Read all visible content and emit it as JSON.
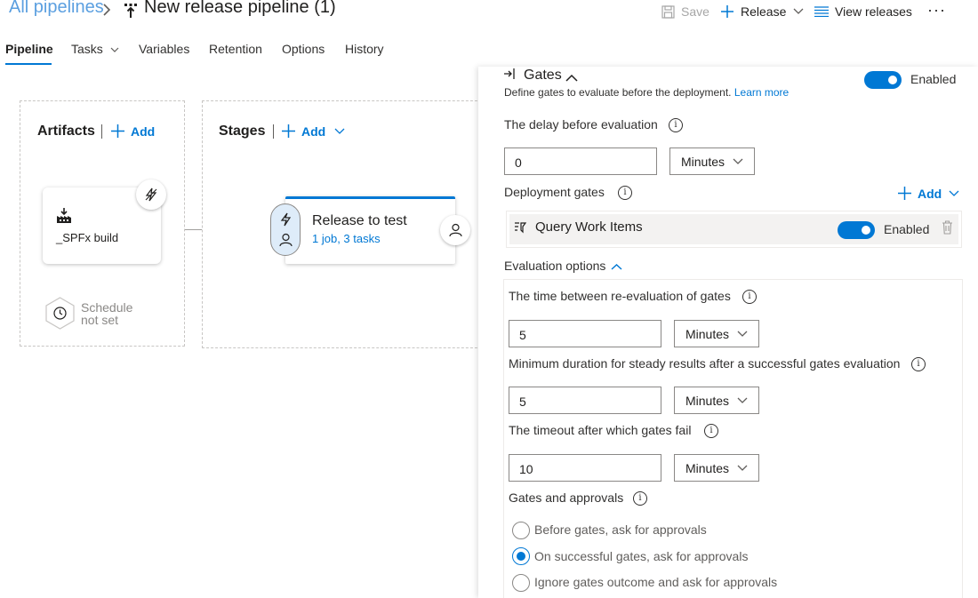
{
  "header": {
    "breadcrumb_root": "All pipelines",
    "title": "New release pipeline (1)",
    "save_label": "Save",
    "release_label": "Release",
    "view_releases_label": "View releases",
    "more_label": "···"
  },
  "tabs": [
    {
      "label": "Pipeline"
    },
    {
      "label": "Tasks"
    },
    {
      "label": "Variables"
    },
    {
      "label": "Retention"
    },
    {
      "label": "Options"
    },
    {
      "label": "History"
    }
  ],
  "artifacts": {
    "title": "Artifacts",
    "add_label": "Add",
    "card_label": "_SPFx build",
    "schedule_line1": "Schedule",
    "schedule_line2": "not set"
  },
  "stages": {
    "title": "Stages",
    "add_label": "Add",
    "stage_name": "Release to test",
    "stage_detail": "1 job, 3 tasks"
  },
  "panel": {
    "title": "Gates",
    "subtitle": "Define gates to evaluate before the deployment.",
    "learn_more": "Learn more",
    "enabled_label": "Enabled",
    "delay_label": "The delay before evaluation",
    "delay_value": "0",
    "delay_unit": "Minutes",
    "deployment_gates_label": "Deployment gates",
    "add_label": "Add",
    "gate_name": "Query Work Items",
    "gate_enabled_label": "Enabled",
    "evaluation_options_label": "Evaluation options",
    "reeval_label": "The time between re-evaluation of gates",
    "reeval_value": "5",
    "reeval_unit": "Minutes",
    "min_duration_label": "Minimum duration for steady results after a successful gates evaluation",
    "min_duration_value": "5",
    "min_duration_unit": "Minutes",
    "timeout_label": "The timeout after which gates fail",
    "timeout_value": "10",
    "timeout_unit": "Minutes",
    "gates_approvals_label": "Gates and approvals",
    "radio_options": [
      {
        "label": "Before gates, ask for approvals",
        "checked": false
      },
      {
        "label": "On successful gates, ask for approvals",
        "checked": true
      },
      {
        "label": "Ignore gates outcome and ask for approvals",
        "checked": false
      }
    ]
  },
  "colors": {
    "accent": "#0078d4",
    "link_light": "#5b9fe0"
  }
}
